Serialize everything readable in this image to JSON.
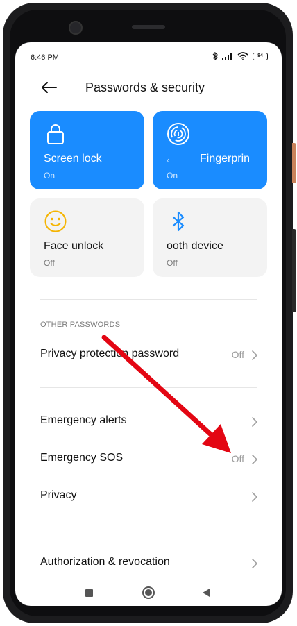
{
  "status_bar": {
    "time": "6:46 PM",
    "battery": "84",
    "icons": [
      "bluetooth-icon",
      "signal-icon",
      "wifi-icon",
      "battery-icon"
    ]
  },
  "header": {
    "title": "Passwords & security"
  },
  "tiles": [
    {
      "title": "Screen lock",
      "status": "On",
      "icon": "lock-icon"
    },
    {
      "title": "Fingerprin",
      "status": "On",
      "icon": "fingerprint-icon",
      "prefix": "‹"
    },
    {
      "title": "Face unlock",
      "status": "Off",
      "icon": "smile-icon"
    },
    {
      "title": "ooth device",
      "status": "Off",
      "icon": "bluetooth-icon"
    }
  ],
  "section_other_passwords": "OTHER PASSWORDS",
  "rows": {
    "privacy_protection_password": {
      "label": "Privacy protection password",
      "value": "Off"
    },
    "emergency_alerts": {
      "label": "Emergency alerts"
    },
    "emergency_sos": {
      "label": "Emergency SOS",
      "value": "Off"
    },
    "privacy": {
      "label": "Privacy"
    },
    "authorization_revocation": {
      "label": "Authorization & revocation"
    }
  },
  "colors": {
    "accent_blue": "#1a8cff",
    "tile_gray": "#f3f3f3",
    "smile_yellow": "#f5b400",
    "bluetooth_blue": "#1a8cff",
    "annotation_arrow": "#e30613"
  }
}
